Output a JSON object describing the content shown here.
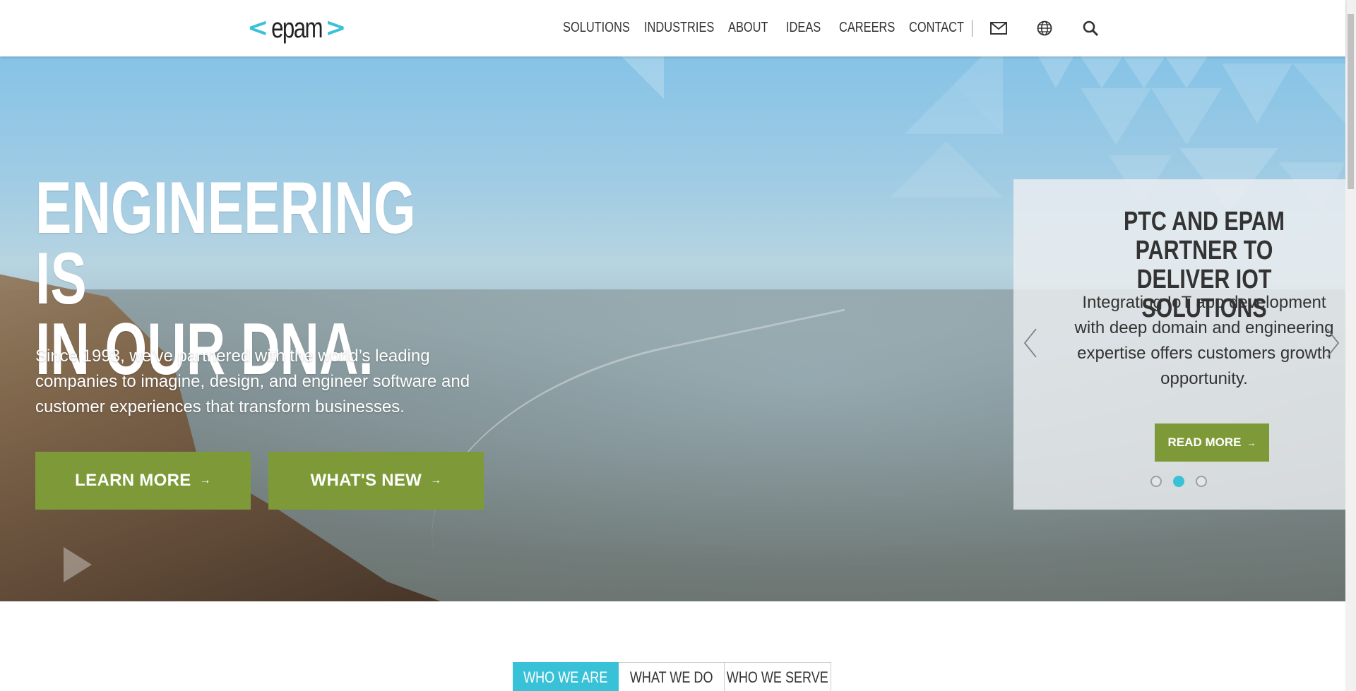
{
  "header": {
    "logo_text": "epam",
    "logo_left": "<",
    "logo_right": ">",
    "nav": [
      "SOLUTIONS",
      "INDUSTRIES",
      "ABOUT",
      "IDEAS",
      "CAREERS",
      "CONTACT"
    ],
    "icons": [
      "mail-icon",
      "globe-icon",
      "search-icon"
    ]
  },
  "hero": {
    "title_line1": "ENGINEERING IS",
    "title_line2": "IN OUR DNA.",
    "description": "Since 1993, we’ve partnered with the world’s leading companies to imagine, design, and engineer software and customer experiences that transform businesses.",
    "buttons": [
      {
        "label": "LEARN MORE",
        "arrow": "→"
      },
      {
        "label": "WHAT'S NEW",
        "arrow": "→"
      }
    ]
  },
  "slider": {
    "title": "PTC AND EPAM PARTNER TO DELIVER IOT SOLUTIONS",
    "description": "Integrating IoT app development with deep domain and engineering expertise offers customers growth opportunity.",
    "button_label": "READ MORE",
    "button_arrow": "→",
    "slide_count": 3,
    "active_slide": 2
  },
  "tabs": {
    "items": [
      "WHO WE ARE",
      "WHAT WE DO",
      "WHO WE SERVE"
    ],
    "active": 0
  },
  "colors": {
    "accent_teal": "#39c2d7",
    "button_green": "#7e9a38",
    "text_dark": "#333333"
  }
}
